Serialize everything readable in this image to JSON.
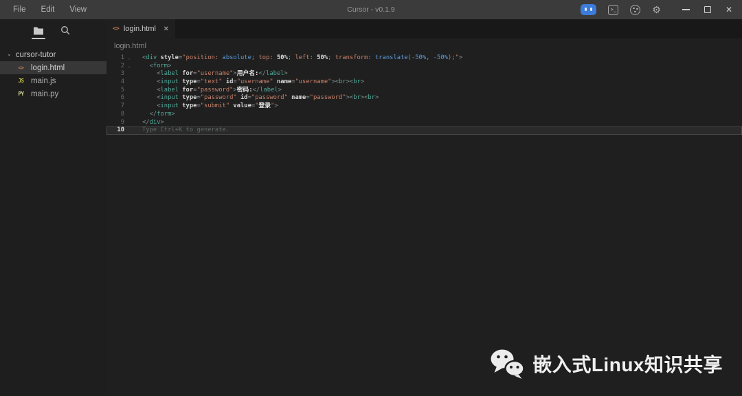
{
  "titlebar": {
    "menus": [
      "File",
      "Edit",
      "View"
    ],
    "title": "Cursor - v0.1.9",
    "window_controls": {
      "close_glyph": "✕",
      "gear_glyph": "⚙",
      "terminal_glyph": ">_"
    }
  },
  "sidebar": {
    "root_folder": "cursor-tutor",
    "root_chevron": "⌄",
    "files": [
      {
        "name": "login.html",
        "badge": "<>",
        "badge_color": "#bf7a52",
        "selected": true
      },
      {
        "name": "main.js",
        "badge": "JS",
        "badge_color": "#cbcb41",
        "selected": false
      },
      {
        "name": "main.py",
        "badge": "PY",
        "badge_color": "#d8d89a",
        "selected": false
      }
    ]
  },
  "tabs": [
    {
      "label": "login.html",
      "icon_glyph": "<>",
      "close_glyph": "✕",
      "active": true
    }
  ],
  "breadcrumb": "login.html",
  "editor": {
    "active_line": 10,
    "ghost_text": "Type Ctrl+K to generate.",
    "fold_glyph": "⌄",
    "lines": [
      {
        "n": 1,
        "fold": true,
        "tokens": [
          [
            "p",
            "<"
          ],
          [
            "t",
            "div"
          ],
          [
            "w",
            " "
          ],
          [
            "a",
            "style"
          ],
          [
            "o",
            "="
          ],
          [
            "s",
            "\"position: "
          ],
          [
            "k",
            "absolute"
          ],
          [
            "s",
            "; top: "
          ],
          [
            "n",
            "50%"
          ],
          [
            "s",
            "; left: "
          ],
          [
            "n",
            "50%"
          ],
          [
            "s",
            "; transform: "
          ],
          [
            "k",
            "translate(-50%, -50%)"
          ],
          [
            "s",
            ";\""
          ],
          [
            "p",
            ">"
          ]
        ]
      },
      {
        "n": 2,
        "fold": true,
        "tokens": [
          [
            "w",
            "  "
          ],
          [
            "p",
            "<"
          ],
          [
            "t",
            "form"
          ],
          [
            "p",
            ">"
          ]
        ]
      },
      {
        "n": 3,
        "fold": false,
        "tokens": [
          [
            "w",
            "    "
          ],
          [
            "p",
            "<"
          ],
          [
            "t",
            "label"
          ],
          [
            "w",
            " "
          ],
          [
            "a",
            "for"
          ],
          [
            "o",
            "="
          ],
          [
            "s",
            "\"username\""
          ],
          [
            "p",
            ">"
          ],
          [
            "c",
            "用户名:"
          ],
          [
            "p",
            "</"
          ],
          [
            "t",
            "label"
          ],
          [
            "p",
            ">"
          ]
        ]
      },
      {
        "n": 4,
        "fold": false,
        "tokens": [
          [
            "w",
            "    "
          ],
          [
            "p",
            "<"
          ],
          [
            "t",
            "input"
          ],
          [
            "w",
            " "
          ],
          [
            "a",
            "type"
          ],
          [
            "o",
            "="
          ],
          [
            "s",
            "\"text\""
          ],
          [
            "w",
            " "
          ],
          [
            "a",
            "id"
          ],
          [
            "o",
            "="
          ],
          [
            "s",
            "\"username\""
          ],
          [
            "w",
            " "
          ],
          [
            "a",
            "name"
          ],
          [
            "o",
            "="
          ],
          [
            "s",
            "\"username\""
          ],
          [
            "p",
            ">"
          ],
          [
            "p",
            "<"
          ],
          [
            "t",
            "br"
          ],
          [
            "p",
            "><"
          ],
          [
            "t",
            "br"
          ],
          [
            "p",
            ">"
          ]
        ]
      },
      {
        "n": 5,
        "fold": false,
        "tokens": [
          [
            "w",
            "    "
          ],
          [
            "p",
            "<"
          ],
          [
            "t",
            "label"
          ],
          [
            "w",
            " "
          ],
          [
            "a",
            "for"
          ],
          [
            "o",
            "="
          ],
          [
            "s",
            "\"password\""
          ],
          [
            "p",
            ">"
          ],
          [
            "c",
            "密码:"
          ],
          [
            "p",
            "</"
          ],
          [
            "t",
            "label"
          ],
          [
            "p",
            ">"
          ]
        ]
      },
      {
        "n": 6,
        "fold": false,
        "tokens": [
          [
            "w",
            "    "
          ],
          [
            "p",
            "<"
          ],
          [
            "t",
            "input"
          ],
          [
            "w",
            " "
          ],
          [
            "a",
            "type"
          ],
          [
            "o",
            "="
          ],
          [
            "s",
            "\"password\""
          ],
          [
            "w",
            " "
          ],
          [
            "a",
            "id"
          ],
          [
            "o",
            "="
          ],
          [
            "s",
            "\"password\""
          ],
          [
            "w",
            " "
          ],
          [
            "a",
            "name"
          ],
          [
            "o",
            "="
          ],
          [
            "s",
            "\"password\""
          ],
          [
            "p",
            ">"
          ],
          [
            "p",
            "<"
          ],
          [
            "t",
            "br"
          ],
          [
            "p",
            "><"
          ],
          [
            "t",
            "br"
          ],
          [
            "p",
            ">"
          ]
        ]
      },
      {
        "n": 7,
        "fold": false,
        "tokens": [
          [
            "w",
            "    "
          ],
          [
            "p",
            "<"
          ],
          [
            "t",
            "input"
          ],
          [
            "w",
            " "
          ],
          [
            "a",
            "type"
          ],
          [
            "o",
            "="
          ],
          [
            "s",
            "\"submit\""
          ],
          [
            "w",
            " "
          ],
          [
            "a",
            "value"
          ],
          [
            "o",
            "="
          ],
          [
            "s",
            "\""
          ],
          [
            "c",
            "登录"
          ],
          [
            "s",
            "\""
          ],
          [
            "p",
            ">"
          ]
        ]
      },
      {
        "n": 8,
        "fold": false,
        "tokens": [
          [
            "w",
            "  "
          ],
          [
            "p",
            "</"
          ],
          [
            "t",
            "form"
          ],
          [
            "p",
            ">"
          ]
        ]
      },
      {
        "n": 9,
        "fold": false,
        "tokens": [
          [
            "p",
            "</"
          ],
          [
            "t",
            "div"
          ],
          [
            "p",
            ">"
          ]
        ]
      },
      {
        "n": 10,
        "ghost": true
      }
    ]
  },
  "watermark": {
    "text": "嵌入式Linux知识共享",
    "icon": "wechat-icon"
  },
  "colors": {
    "titlebar_bg": "#3b3b3b",
    "editor_bg": "#1f1f1f",
    "sidebar_bg": "#1e1e1e",
    "tabstrip_bg": "#181818",
    "selected_row_bg": "#373737",
    "robot_accent": "#3d7bd9",
    "tag": "#4fa99a",
    "string": "#c9826b",
    "css_keyword": "#5d9ddb",
    "attr": "#d6d6d6",
    "ghost": "#5f6a64"
  }
}
